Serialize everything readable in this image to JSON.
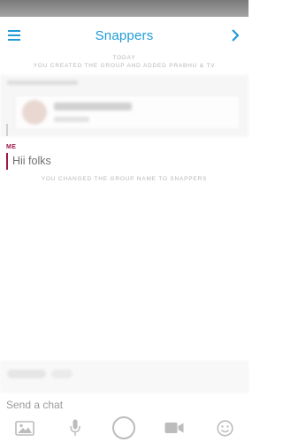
{
  "header": {
    "title": "Snappers"
  },
  "conversation": {
    "day_label": "TODAY",
    "system_messages": [
      "YOU CREATED THE GROUP AND ADDED PRABHU & TV",
      "YOU CHANGED THE GROUP NAME TO SNAPPERS"
    ],
    "messages": [
      {
        "sender": "ME",
        "text": "Hii folks"
      }
    ]
  },
  "composer": {
    "placeholder": "Send a chat"
  },
  "toolbar": {
    "icons": [
      "image-icon",
      "microphone-icon",
      "capture-button",
      "video-camera-icon",
      "emoji-icon"
    ]
  },
  "colors": {
    "accent": "#1f9bd8",
    "me_label": "#a0174a",
    "system_text": "#b7b7b7",
    "icon_gray": "#bcbcbc"
  }
}
